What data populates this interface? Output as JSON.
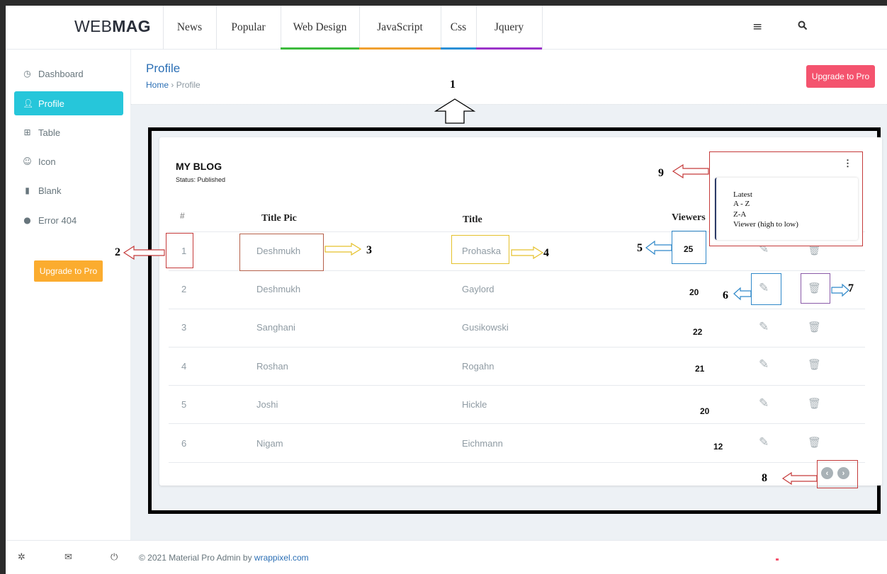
{
  "brand": {
    "light": "WEB",
    "bold": "MAG"
  },
  "nav": [
    {
      "label": "News",
      "underline": ""
    },
    {
      "label": "Popular",
      "underline": ""
    },
    {
      "label": "Web Design",
      "underline": "#3dbb3d"
    },
    {
      "label": "JavaScript",
      "underline": "#f0a030"
    },
    {
      "label": "Css",
      "underline": "#2b8fd6"
    },
    {
      "label": "Jquery",
      "underline": "#9b34c9"
    }
  ],
  "topbar_icons": [
    "menu-icon",
    "search-icon"
  ],
  "sidebar": {
    "items": [
      {
        "label": "Dashboard",
        "icon": "clock-icon",
        "active": false
      },
      {
        "label": "Profile",
        "icon": "user-icon",
        "active": true
      },
      {
        "label": "Table",
        "icon": "table-icon",
        "active": false
      },
      {
        "label": "Icon",
        "icon": "smile-icon",
        "active": false
      },
      {
        "label": "Blank",
        "icon": "book-icon",
        "active": false
      },
      {
        "label": "Error 404",
        "icon": "help-icon",
        "active": false
      }
    ],
    "upgrade_label": "Upgrade to Pro"
  },
  "page": {
    "title": "Profile",
    "breadcrumb": {
      "home": "Home",
      "separator": "›",
      "current": "Profile"
    },
    "upgrade_label": "Upgrade to Pro"
  },
  "blog": {
    "title": "MY BLOG",
    "status": "Status: Published",
    "columns": {
      "num": "#",
      "pic": "Title Pic",
      "title": "Title",
      "viewers": "Viewers"
    },
    "rows": [
      {
        "num": "1",
        "pic": "Deshmukh",
        "title": "Prohaska",
        "viewers": "25"
      },
      {
        "num": "2",
        "pic": "Deshmukh",
        "title": "Gaylord",
        "viewers": "20"
      },
      {
        "num": "3",
        "pic": "Sanghani",
        "title": "Gusikowski",
        "viewers": "22"
      },
      {
        "num": "4",
        "pic": "Roshan",
        "title": "Rogahn",
        "viewers": "21"
      },
      {
        "num": "5",
        "pic": "Joshi",
        "title": "Hickle",
        "viewers": "20"
      },
      {
        "num": "6",
        "pic": "Nigam",
        "title": "Eichmann",
        "viewers": "12"
      }
    ],
    "sort_menu": [
      "Latest",
      "A - Z",
      "Z-A",
      "Viewer (high to low)"
    ],
    "kebab": "⋮"
  },
  "annotations": [
    "1",
    "2",
    "3",
    "4",
    "5",
    "6",
    "7",
    "8",
    "9"
  ],
  "footer": {
    "text": "© 2021 Material Pro Admin by ",
    "link": "wrappixel.com"
  },
  "colors": {
    "accent": "#26c6da",
    "upgrade_sidebar": "#fbac2f",
    "upgrade_top": "#f4536e",
    "link": "#2b6fb5"
  }
}
